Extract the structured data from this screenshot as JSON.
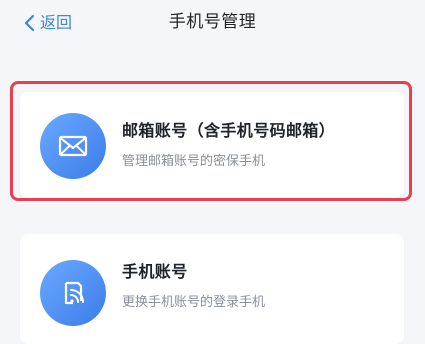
{
  "header": {
    "back_label": "返回",
    "title": "手机号管理"
  },
  "cards": [
    {
      "icon": "mail-icon",
      "title": "邮箱账号（含手机号码邮箱）",
      "description": "管理邮箱账号的密保手机",
      "highlighted": true
    },
    {
      "icon": "phone-account-icon",
      "title": "手机账号",
      "description": "更换手机账号的登录手机",
      "highlighted": false
    }
  ],
  "colors": {
    "accent": "#3d86d8",
    "highlight_border": "#e8404f",
    "icon_gradient_start": "#6aa9ff",
    "icon_gradient_end": "#3c7ce8",
    "background": "#f4f6f9"
  }
}
